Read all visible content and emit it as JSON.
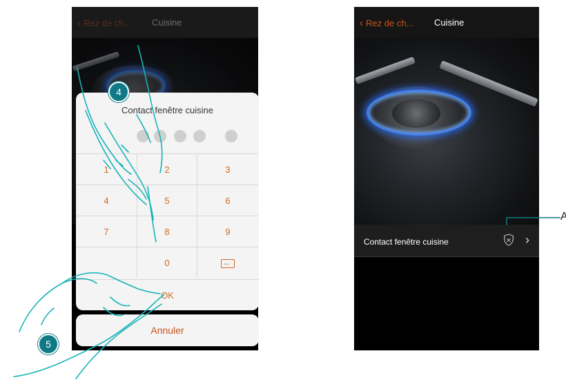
{
  "left_screen": {
    "back_label": "Rez de ch...",
    "title": "Cuisine",
    "dialog_title": "Contact fenêtre cuisine",
    "keys": [
      "1",
      "2",
      "3",
      "4",
      "5",
      "6",
      "7",
      "8",
      "9",
      "",
      "0",
      ""
    ],
    "ok_label": "OK",
    "cancel_label": "Annuler"
  },
  "right_screen": {
    "back_label": "Rez de ch...",
    "title": "Cuisine",
    "contact_label": "Contact fenêtre cuisine"
  },
  "markers": {
    "step_4": "4",
    "step_5": "5"
  },
  "callout": {
    "label": "A"
  },
  "icons": [
    "chevron-left-icon",
    "backspace-icon",
    "shield-icon",
    "chevron-right-icon",
    "hand-pointer-icon"
  ],
  "colors": {
    "accent": "#c8541e",
    "marker": "#0f7a86",
    "nav": "#151515"
  }
}
